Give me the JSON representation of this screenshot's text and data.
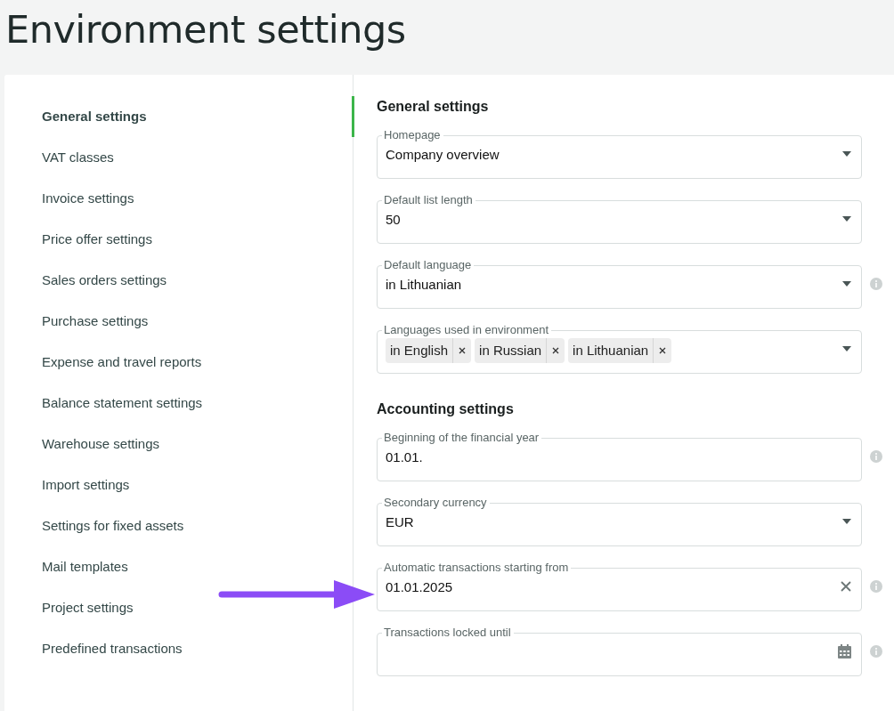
{
  "page": {
    "title": "Environment settings"
  },
  "sidebar": {
    "items": [
      {
        "label": "General settings",
        "selected": true
      },
      {
        "label": "VAT classes",
        "selected": false
      },
      {
        "label": "Invoice settings",
        "selected": false
      },
      {
        "label": "Price offer settings",
        "selected": false
      },
      {
        "label": "Sales orders settings",
        "selected": false
      },
      {
        "label": "Purchase settings",
        "selected": false
      },
      {
        "label": "Expense and travel reports",
        "selected": false
      },
      {
        "label": "Balance statement settings",
        "selected": false
      },
      {
        "label": "Warehouse settings",
        "selected": false
      },
      {
        "label": "Import settings",
        "selected": false
      },
      {
        "label": "Settings for fixed assets",
        "selected": false
      },
      {
        "label": "Mail templates",
        "selected": false
      },
      {
        "label": "Project settings",
        "selected": false
      },
      {
        "label": "Predefined transactions",
        "selected": false
      }
    ]
  },
  "sections": [
    {
      "title": "General settings",
      "fields": [
        {
          "kind": "select",
          "label": "Homepage",
          "value": "Company overview",
          "info": false
        },
        {
          "kind": "select",
          "label": "Default list length",
          "value": "50",
          "info": false
        },
        {
          "kind": "select",
          "label": "Default language",
          "value": "in Lithuanian",
          "info": true
        },
        {
          "kind": "multiselect",
          "label": "Languages used in environment",
          "chips": [
            "in English",
            "in Russian",
            "in Lithuanian"
          ],
          "info": false
        }
      ]
    },
    {
      "title": "Accounting settings",
      "fields": [
        {
          "kind": "text",
          "label": "Beginning of the financial year",
          "value": "01.01.",
          "info": true
        },
        {
          "kind": "select",
          "label": "Secondary currency",
          "value": "EUR",
          "info": false
        },
        {
          "kind": "clearable",
          "label": "Automatic transactions starting from",
          "value": "01.01.2025",
          "info": true,
          "highlighted": true
        },
        {
          "kind": "date",
          "label": "Transactions locked until",
          "info": true
        }
      ]
    }
  ]
}
